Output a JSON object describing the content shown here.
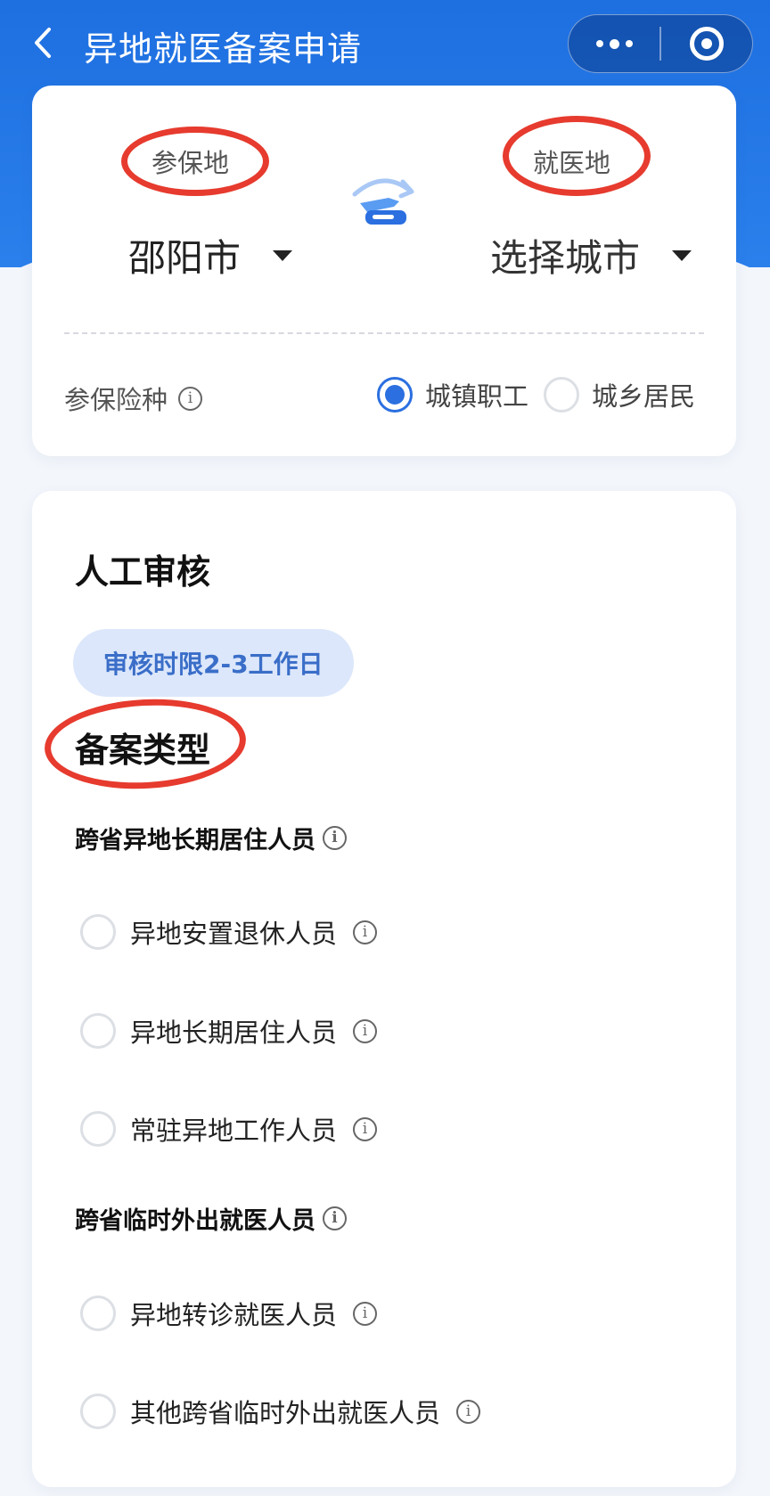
{
  "header": {
    "title": "异地就医备案申请"
  },
  "location": {
    "insured_label": "参保地",
    "insured_city": "邵阳市",
    "treatment_label": "就医地",
    "treatment_city": "选择城市"
  },
  "insurance": {
    "label": "参保险种",
    "options": [
      {
        "label": "城镇职工",
        "checked": true
      },
      {
        "label": "城乡居民",
        "checked": false
      }
    ]
  },
  "review": {
    "title": "人工审核",
    "badge": "审核时限2-3工作日"
  },
  "filing": {
    "title": "备案类型",
    "groups": [
      {
        "label": "跨省异地长期居住人员",
        "options": [
          "异地安置退休人员",
          "异地长期居住人员",
          "常驻异地工作人员"
        ]
      },
      {
        "label": "跨省临时外出就医人员",
        "options": [
          "异地转诊就医人员",
          "其他跨省临时外出就医人员"
        ]
      }
    ]
  },
  "colors": {
    "primary": "#2b6fe0",
    "header_bg": "#1e6fe0",
    "annotation": "#e63b2e",
    "badge_bg": "#dce7fb",
    "badge_text": "#3a6ec8"
  },
  "icons": {
    "back": "chevron-left-icon",
    "more": "more-dots-icon",
    "close": "target-circle-icon",
    "swap": "swap-route-icon",
    "info": "info-circle-icon"
  }
}
